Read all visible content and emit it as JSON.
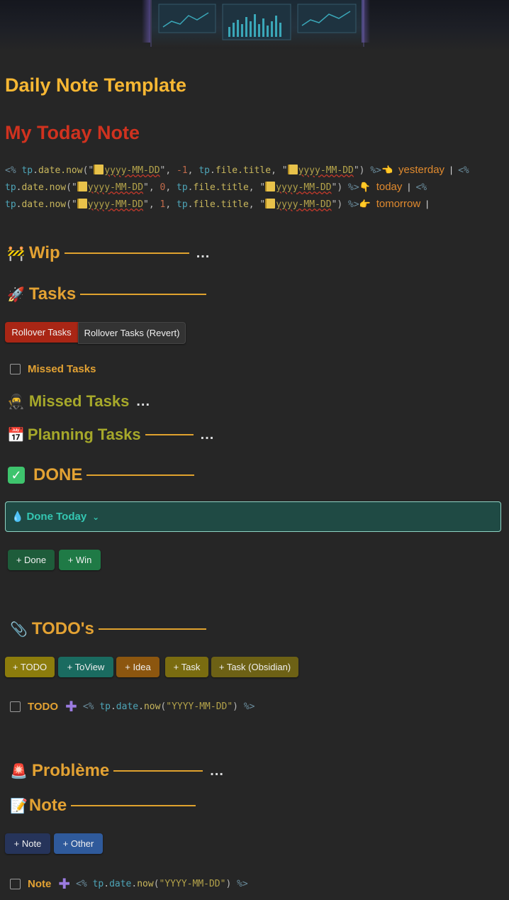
{
  "header": {
    "template_title": "Daily Note Template",
    "today_title": "My Today Note"
  },
  "nav_code": {
    "tag_open": "<%",
    "tag_close": "%>",
    "tp": "tp",
    "date_now": "date.now",
    "fmt": "yyyy-MM-DD",
    "file_title": "file.title",
    "offset_yesterday": "-1",
    "offset_today": "0",
    "offset_tomorrow": "1",
    "yesterday": "yesterday",
    "today": "today",
    "tomorrow": "tomorrow"
  },
  "sections": {
    "wip": "Wip",
    "tasks": "Tasks",
    "missed_tasks": "Missed Tasks",
    "planning_tasks": "Planning Tasks",
    "done": "DONE",
    "todos": "TODO's",
    "probleme": "Problème",
    "note": "Note",
    "more": "..."
  },
  "buttons": {
    "rollover": "Rollover Tasks",
    "rollover_revert": "Rollover Tasks (Revert)",
    "done": "+ Done",
    "win": "+ Win",
    "todo": "+ TODO",
    "toview": "+ ToView",
    "idea": "+ Idea",
    "task": "+ Task",
    "task_obsidian": "+ Task (Obsidian)",
    "note": "+ Note",
    "other": "+ Other"
  },
  "checklist": {
    "missed": "Missed Tasks",
    "todo": "TODO",
    "note": "Note"
  },
  "callout": {
    "done_today": "Done Today"
  },
  "inline_code": {
    "open": "<%",
    "tp": "tp",
    "date": "date",
    "now": "now",
    "fmt": "\"YYYY-MM-DD\"",
    "close": "%>"
  },
  "colors": {
    "background": "#262626",
    "heading_yellow": "#f7b733",
    "heading_red": "#d0321f",
    "section_orange": "#e3a233",
    "section_olive": "#a6a82a",
    "callout_bg": "#1f4a44",
    "callout_border": "#8fd3c4"
  },
  "icons": [
    "construction-icon",
    "rocket-icon",
    "ninja-icon",
    "calendar-icon",
    "check-mark-icon",
    "drop-icon",
    "chevron-down-icon",
    "paperclip-icon",
    "siren-icon",
    "memo-icon",
    "plus-icon",
    "hand-left-icon",
    "hand-down-icon",
    "hand-right-icon",
    "notepad-icon"
  ]
}
